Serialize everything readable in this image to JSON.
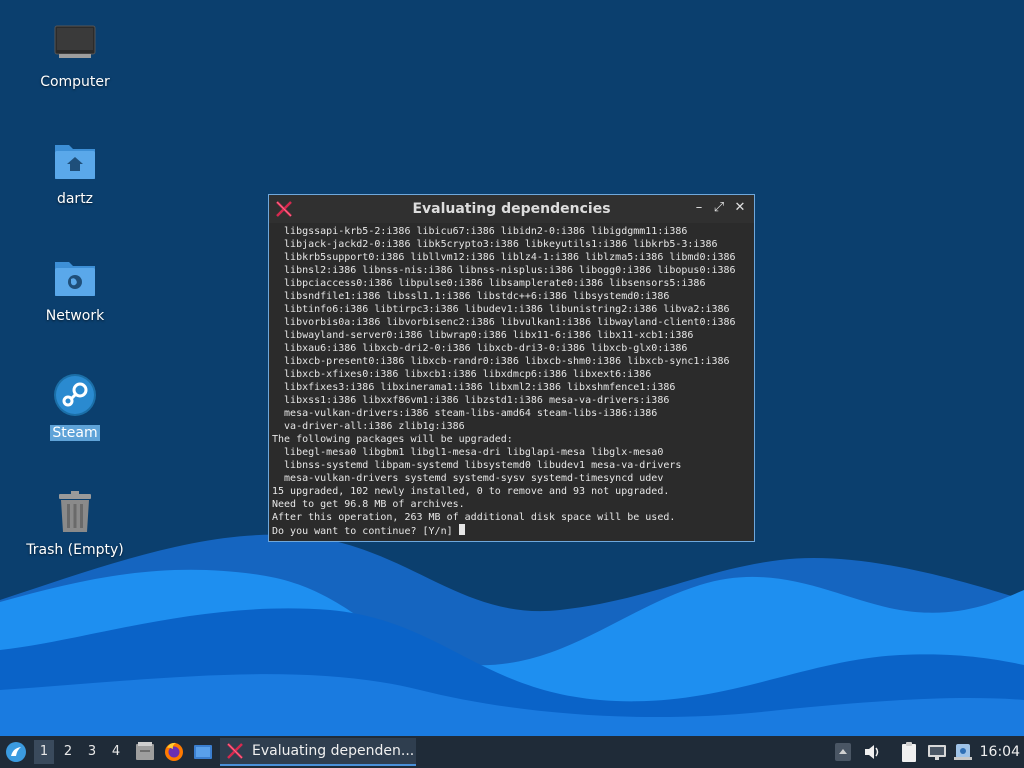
{
  "desktop": {
    "icons": [
      {
        "label": "Computer"
      },
      {
        "label": "dartz"
      },
      {
        "label": "Network"
      },
      {
        "label": "Steam"
      },
      {
        "label": "Trash (Empty)"
      }
    ]
  },
  "terminal": {
    "title": "Evaluating dependencies",
    "lines": [
      "  libgssapi-krb5-2:i386 libicu67:i386 libidn2-0:i386 libigdgmm11:i386",
      "  libjack-jackd2-0:i386 libk5crypto3:i386 libkeyutils1:i386 libkrb5-3:i386",
      "  libkrb5support0:i386 libllvm12:i386 liblz4-1:i386 liblzma5:i386 libmd0:i386",
      "  libnsl2:i386 libnss-nis:i386 libnss-nisplus:i386 libogg0:i386 libopus0:i386",
      "  libpciaccess0:i386 libpulse0:i386 libsamplerate0:i386 libsensors5:i386",
      "  libsndfile1:i386 libssl1.1:i386 libstdc++6:i386 libsystemd0:i386",
      "  libtinfo6:i386 libtirpc3:i386 libudev1:i386 libunistring2:i386 libva2:i386",
      "  libvorbis0a:i386 libvorbisenc2:i386 libvulkan1:i386 libwayland-client0:i386",
      "  libwayland-server0:i386 libwrap0:i386 libx11-6:i386 libx11-xcb1:i386",
      "  libxau6:i386 libxcb-dri2-0:i386 libxcb-dri3-0:i386 libxcb-glx0:i386",
      "  libxcb-present0:i386 libxcb-randr0:i386 libxcb-shm0:i386 libxcb-sync1:i386",
      "  libxcb-xfixes0:i386 libxcb1:i386 libxdmcp6:i386 libxext6:i386",
      "  libxfixes3:i386 libxinerama1:i386 libxml2:i386 libxshmfence1:i386",
      "  libxss1:i386 libxxf86vm1:i386 libzstd1:i386 mesa-va-drivers:i386",
      "  mesa-vulkan-drivers:i386 steam-libs-amd64 steam-libs-i386:i386",
      "  va-driver-all:i386 zlib1g:i386",
      "The following packages will be upgraded:",
      "  libegl-mesa0 libgbm1 libgl1-mesa-dri libglapi-mesa libglx-mesa0",
      "  libnss-systemd libpam-systemd libsystemd0 libudev1 mesa-va-drivers",
      "  mesa-vulkan-drivers systemd systemd-sysv systemd-timesyncd udev",
      "15 upgraded, 102 newly installed, 0 to remove and 93 not upgraded.",
      "Need to get 96.8 MB of archives.",
      "After this operation, 263 MB of additional disk space will be used.",
      "Do you want to continue? [Y/n] "
    ],
    "buttons": {
      "minimize": "–",
      "maximize": "⤢",
      "close": "✕"
    }
  },
  "taskbar": {
    "workspaces": [
      "1",
      "2",
      "3",
      "4"
    ],
    "active_workspace": "1",
    "task_label": "Evaluating dependen...",
    "clock": "16:04"
  },
  "colors": {
    "desktop_bg": "#0b3f6e",
    "wave_light": "#1e8ff0",
    "wave_dark": "#0a63c8",
    "taskbar_bg": "#1f2b38",
    "accent": "#4a90d9"
  }
}
